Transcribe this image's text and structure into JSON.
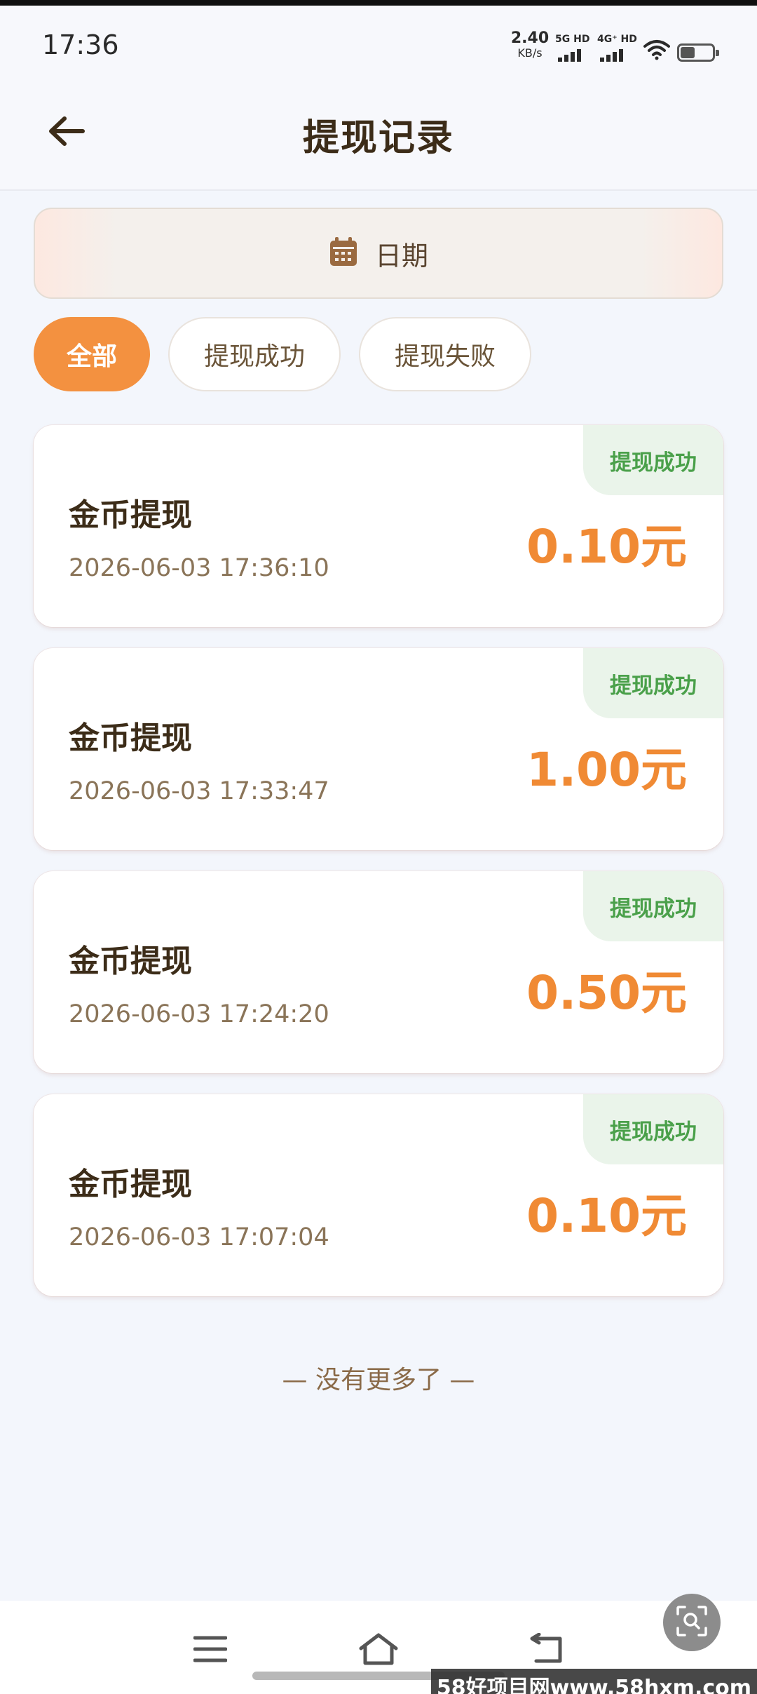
{
  "status_bar": {
    "time": "17:36",
    "net_speed_value": "2.40",
    "net_speed_unit": "KB/s",
    "sim1_label": "5G HD",
    "sim2_label": "4G⁺ HD",
    "battery_icon": "battery-icon",
    "wifi_icon": "wifi-icon"
  },
  "header": {
    "title": "提现记录",
    "back_icon": "arrow-left-icon"
  },
  "date_filter": {
    "icon": "calendar-icon",
    "label": "日期"
  },
  "tabs": [
    {
      "label": "全部",
      "active": true
    },
    {
      "label": "提现成功",
      "active": false
    },
    {
      "label": "提现失败",
      "active": false
    }
  ],
  "records": [
    {
      "title": "金币提现",
      "time": "2026-06-03 17:36:10",
      "amount": "0.10元",
      "status": "提现成功"
    },
    {
      "title": "金币提现",
      "time": "2026-06-03 17:33:47",
      "amount": "1.00元",
      "status": "提现成功"
    },
    {
      "title": "金币提现",
      "time": "2026-06-03 17:24:20",
      "amount": "0.50元",
      "status": "提现成功"
    },
    {
      "title": "金币提现",
      "time": "2026-06-03 17:07:04",
      "amount": "0.10元",
      "status": "提现成功"
    }
  ],
  "footer_text": "— 没有更多了 —",
  "colors": {
    "accent": "#f39140",
    "amount": "#f08a34",
    "success": "#4aa04a",
    "success_bg": "#eaf4ea",
    "background": "#f3f6fc"
  },
  "nav_bar": {
    "menu_icon": "menu-icon",
    "home_icon": "home-icon",
    "back_icon": "back-icon",
    "scan_icon": "scan-search-icon"
  },
  "watermark": "58好项目网www.58hxm.com"
}
